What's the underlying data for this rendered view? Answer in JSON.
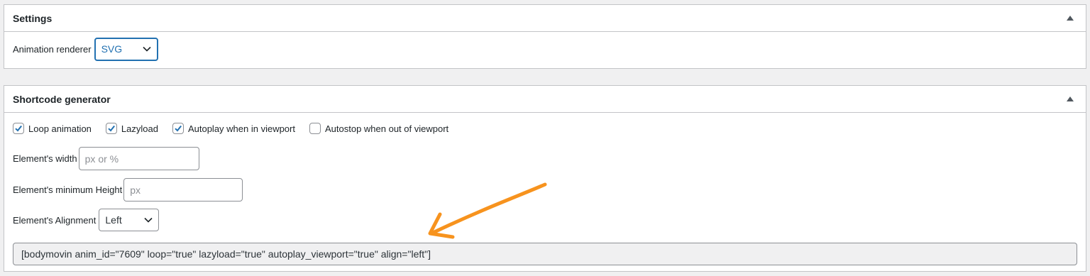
{
  "settings": {
    "title": "Settings",
    "renderer_label": "Animation renderer",
    "renderer_value": "SVG"
  },
  "shortcode": {
    "title": "Shortcode generator",
    "checkboxes": [
      {
        "label": "Loop animation",
        "checked": true
      },
      {
        "label": "Lazyload",
        "checked": true
      },
      {
        "label": "Autoplay when in viewport",
        "checked": true
      },
      {
        "label": "Autostop when out of viewport",
        "checked": false
      }
    ],
    "width_label": "Element's width",
    "width_placeholder": "px or %",
    "min_height_label": "Element's minimum Height",
    "min_height_placeholder": "px",
    "alignment_label": "Element's Alignment",
    "alignment_value": "Left",
    "output": "[bodymovin anim_id=\"7609\" loop=\"true\" lazyload=\"true\" autoplay_viewport=\"true\" align=\"left\"]"
  },
  "colors": {
    "accent": "#2271b1",
    "annotation_arrow": "#f7931e"
  },
  "icons": {
    "collapse": "triangle-up-icon",
    "select_caret": "chevron-down-icon",
    "checkbox_check": "check-icon"
  }
}
